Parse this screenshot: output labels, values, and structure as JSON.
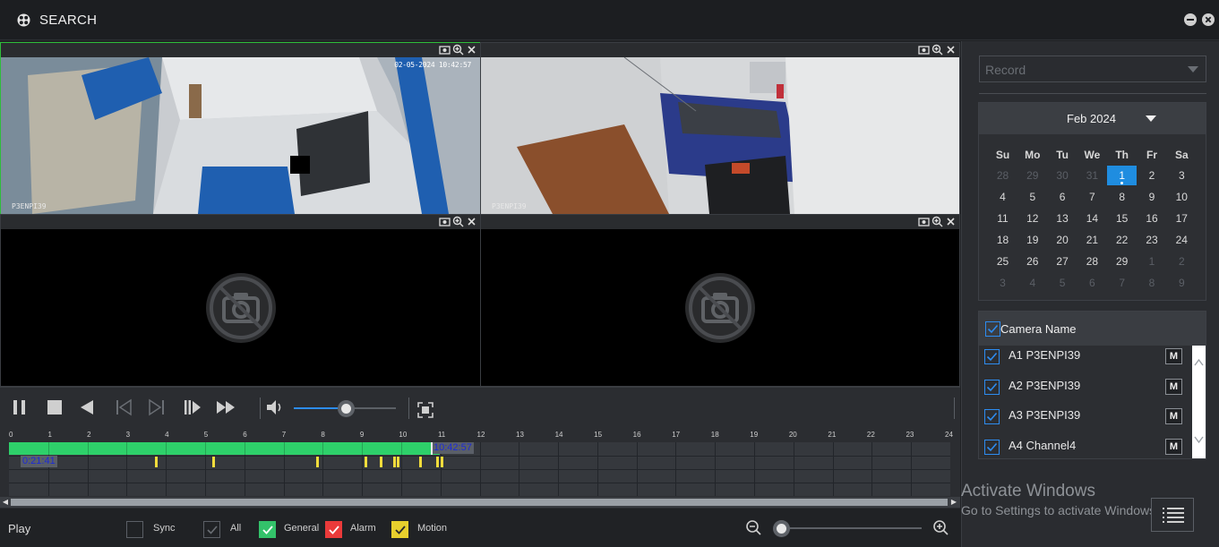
{
  "window": {
    "title": "SEARCH"
  },
  "cells": [
    {
      "name": "cell-1",
      "timestamp": "02-05-2024 10:42:57",
      "camera_label": "P3ENPI39",
      "has_video": true
    },
    {
      "name": "cell-2",
      "timestamp": "",
      "camera_label": "P3ENPI39",
      "has_video": true
    },
    {
      "name": "cell-3",
      "has_video": false
    },
    {
      "name": "cell-4",
      "has_video": false
    }
  ],
  "controls": {
    "buttons": [
      "pause",
      "stop",
      "play-reverse",
      "prev-frame",
      "next-frame",
      "slow-play",
      "fast-forward",
      "volume",
      "fullscreen"
    ],
    "volume_level": 0.5
  },
  "timeline": {
    "hours": [
      "0",
      "1",
      "2",
      "3",
      "4",
      "5",
      "6",
      "7",
      "8",
      "9",
      "10",
      "11",
      "12",
      "13",
      "14",
      "15",
      "16",
      "17",
      "18",
      "19",
      "20",
      "21",
      "22",
      "23",
      "24"
    ],
    "start_time": "0:21:41",
    "current_time": "10:42:57",
    "colors": {
      "general": "#2ed06a",
      "motion": "#f2dc3c"
    }
  },
  "bottom": {
    "play_label": "Play",
    "sync_label": "Sync",
    "all_label": "All",
    "general_label": "General",
    "alarm_label": "Alarm",
    "motion_label": "Motion"
  },
  "right": {
    "record_placeholder": "Record",
    "calendar": {
      "month_label": "Feb 2024",
      "weekdays": [
        "Su",
        "Mo",
        "Tu",
        "We",
        "Th",
        "Fr",
        "Sa"
      ],
      "weeks": [
        [
          "28",
          "29",
          "30",
          "31",
          "1",
          "2",
          "3"
        ],
        [
          "4",
          "5",
          "6",
          "7",
          "8",
          "9",
          "10"
        ],
        [
          "11",
          "12",
          "13",
          "14",
          "15",
          "16",
          "17"
        ],
        [
          "18",
          "19",
          "20",
          "21",
          "22",
          "23",
          "24"
        ],
        [
          "25",
          "26",
          "27",
          "28",
          "29",
          "1",
          "2"
        ],
        [
          "3",
          "4",
          "5",
          "6",
          "7",
          "8",
          "9"
        ]
      ],
      "selected_day": "1"
    },
    "camera_list": {
      "header": "Camera Name",
      "cameras": [
        {
          "label": "A1 P3ENPI39",
          "button": "M",
          "checked": true
        },
        {
          "label": "A2 P3ENPI39",
          "button": "M",
          "checked": true
        },
        {
          "label": "A3 P3ENPI39",
          "button": "M",
          "checked": true
        },
        {
          "label": "A4 Channel4",
          "button": "M",
          "checked": true
        }
      ]
    }
  },
  "os_overlay": {
    "line1": "Activate Windows",
    "line2": "Go to Settings to activate Windows."
  }
}
